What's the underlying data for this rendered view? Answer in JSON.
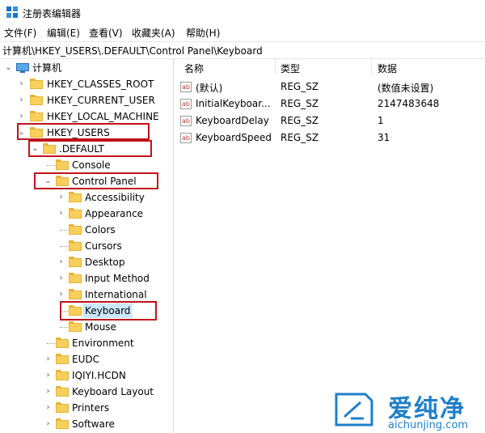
{
  "window": {
    "title": "注册表编辑器"
  },
  "menu": [
    "文件(F)",
    "编辑(E)",
    "查看(V)",
    "收藏夹(A)",
    "帮助(H)"
  ],
  "address": "计算机\\HKEY_USERS\\.DEFAULT\\Control Panel\\Keyboard",
  "tree": {
    "root": "计算机",
    "hives": [
      "HKEY_CLASSES_ROOT",
      "HKEY_CURRENT_USER",
      "HKEY_LOCAL_MACHINE",
      "HKEY_USERS"
    ],
    "default": ".DEFAULT",
    "default_children": [
      "Console",
      "Control Panel"
    ],
    "control_panel_children": [
      "Accessibility",
      "Appearance",
      "Colors",
      "Cursors",
      "Desktop",
      "Input Method",
      "International",
      "Keyboard",
      "Mouse"
    ],
    "more_children": [
      "Environment",
      "EUDC",
      "IQIYI.HCDN",
      "Keyboard Layout",
      "Printers",
      "Software"
    ]
  },
  "list": {
    "headers": {
      "name": "名称",
      "type": "类型",
      "data": "数据"
    },
    "rows": [
      {
        "name": "(默认)",
        "type": "REG_SZ",
        "data": "(数值未设置)"
      },
      {
        "name": "InitialKeyboar...",
        "type": "REG_SZ",
        "data": "2147483648"
      },
      {
        "name": "KeyboardDelay",
        "type": "REG_SZ",
        "data": "1"
      },
      {
        "name": "KeyboardSpeed",
        "type": "REG_SZ",
        "data": "31"
      }
    ]
  },
  "watermark": {
    "brand": "爱纯净",
    "url": "aichunjing.com"
  },
  "colors": {
    "highlight": "#c0121b",
    "selection": "#cce8ff",
    "folder": "#f8cf5b",
    "brand": "#1f7fc8"
  }
}
